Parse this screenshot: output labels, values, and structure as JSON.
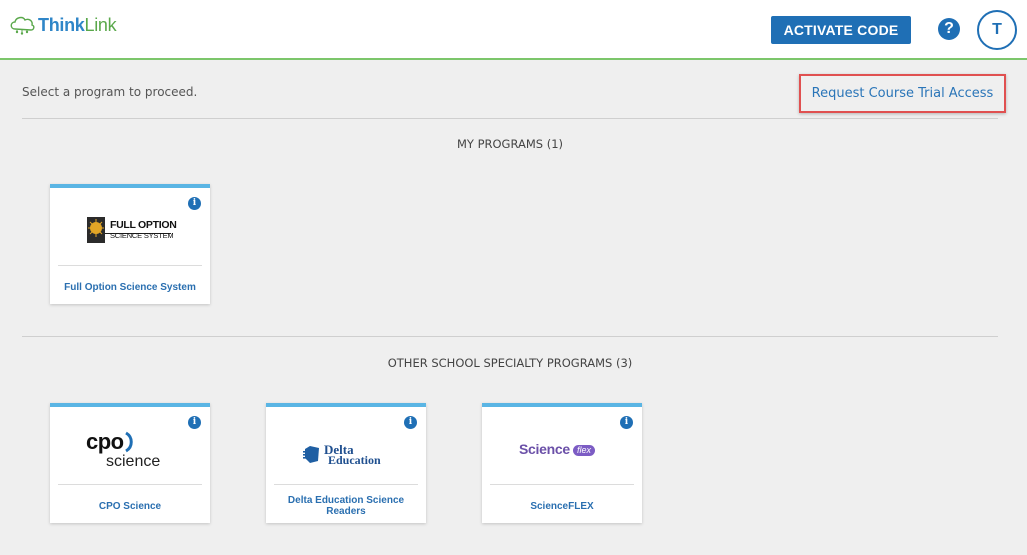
{
  "header": {
    "logo": {
      "think": "Think",
      "link": "Link"
    },
    "activate_label": "ACTIVATE CODE",
    "help_glyph": "?",
    "avatar_initial": "T"
  },
  "main": {
    "instruction": "Select a program to proceed.",
    "trial_link": "Request Course Trial Access",
    "my_programs": {
      "title": "MY PROGRAMS (1)",
      "cards": [
        {
          "name": "Full Option Science System",
          "logo_text_1": "FULL OPTION",
          "logo_text_2": "SCIENCE SYSTEM",
          "logo_badge": "FOSS"
        }
      ]
    },
    "other_programs": {
      "title": "OTHER SCHOOL SPECIALTY PROGRAMS (3)",
      "cards": [
        {
          "name": "CPO Science",
          "logo_text_1": "cpo",
          "logo_text_2": "science"
        },
        {
          "name": "Delta Education Science Readers",
          "logo_text_1": "Delta",
          "logo_text_2": "Education"
        },
        {
          "name": "ScienceFLEX",
          "logo_text_1": "Science",
          "logo_text_2": "flex"
        }
      ]
    }
  },
  "colors": {
    "primary": "#1f6fb5",
    "header_border": "#7cc66b",
    "card_top": "#5ab5e4",
    "highlight_box": "#e05050",
    "background": "#efefef"
  }
}
